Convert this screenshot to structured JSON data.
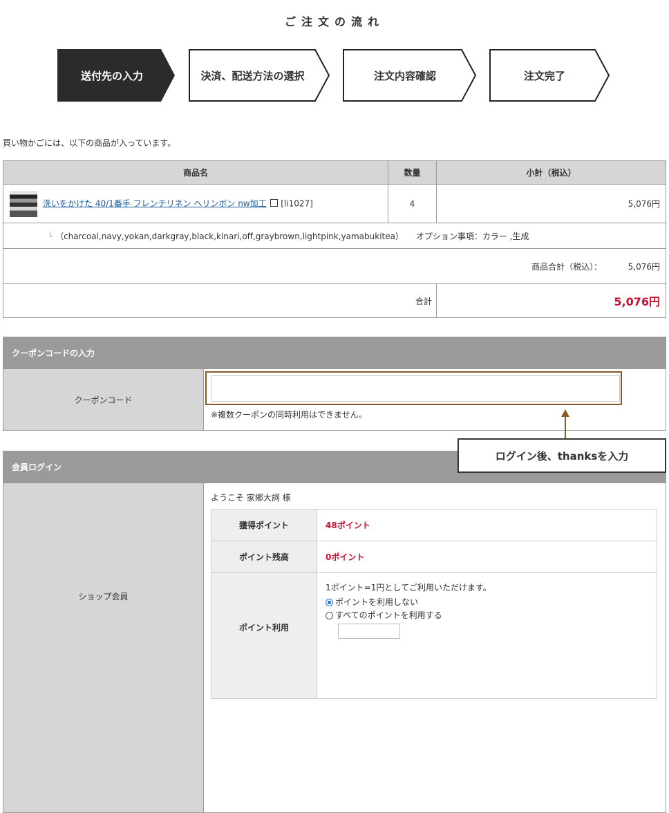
{
  "flow": {
    "title": "ご注文の流れ",
    "steps": [
      {
        "label": "送付先の入力",
        "active": true
      },
      {
        "label": "決済、配送方法の選択",
        "active": false
      },
      {
        "label": "注文内容確認",
        "active": false
      },
      {
        "label": "注文完了",
        "active": false
      }
    ]
  },
  "cart": {
    "intro": "買い物かごには、以下の商品が入っています。",
    "headers": {
      "name": "商品名",
      "qty": "数量",
      "subtotal": "小計（税込）"
    },
    "item": {
      "name": "洗いをかけた 40/1番手 フレンチリネン ヘリンボン nw加工",
      "code": "[li1027]",
      "qty": "4",
      "subtotal": "5,076円",
      "variants": "（charcoal,navy,yokan,darkgray,black,kinari,off,graybrown,lightpink,yamabukitea）",
      "option": "オプション事項：カラー ,生成"
    },
    "product_total_label": "商品合計（税込）：",
    "product_total": "5,076円",
    "total_label": "合計",
    "total": "5,076円"
  },
  "coupon": {
    "section_title": "クーポンコードの入力",
    "label": "クーポンコード",
    "value": "",
    "note": "※複数クーポンの同時利用はできません。"
  },
  "callout": "ログイン後、thanksを入力",
  "member": {
    "section_title": "会員ログイン",
    "label": "ショップ会員",
    "welcome": "ようこそ 家郷大詞 様",
    "earned_label": "獲得ポイント",
    "earned": "48ポイント",
    "balance_label": "ポイント残高",
    "balance": "0ポイント",
    "use_label": "ポイント利用",
    "use_note": "1ポイント=1円としてご利用いただけます。",
    "options": [
      {
        "label": "ポイントを利用しない",
        "checked": true
      },
      {
        "label": "すべてのポイントを利用する",
        "checked": false
      }
    ]
  },
  "colors": {
    "active_step": "#2b2b2b",
    "price_red": "#c8102e",
    "section_head": "#9a9a9a",
    "callout_border": "#8b5a2b"
  }
}
